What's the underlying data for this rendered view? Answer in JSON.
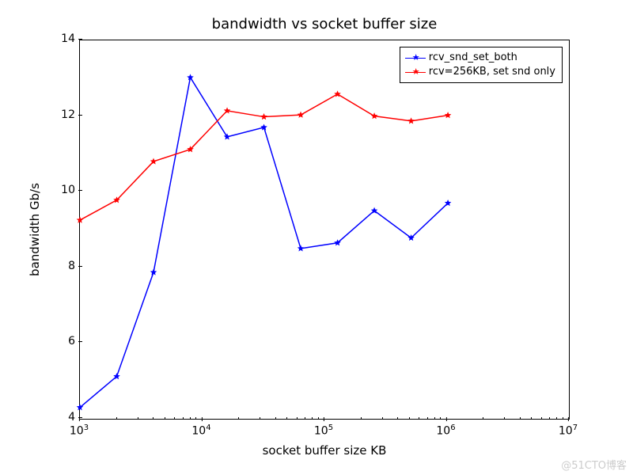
{
  "chart_data": {
    "type": "line",
    "title": "bandwidth vs socket buffer size",
    "xlabel": "socket buffer size KB",
    "ylabel": "bandwidth Gb/s",
    "x_scale": "log",
    "xlim": [
      1000,
      10000000
    ],
    "ylim": [
      4,
      14
    ],
    "xticks_exp": [
      3,
      4,
      5,
      6,
      7
    ],
    "yticks": [
      4,
      6,
      8,
      10,
      12,
      14
    ],
    "x": [
      1000,
      2000,
      4000,
      8000,
      16000,
      32000,
      64000,
      128000,
      256000,
      512000,
      1024000
    ],
    "series": [
      {
        "name": "rcv_snd_set_both",
        "color": "#0000ff",
        "values": [
          4.3,
          5.12,
          7.87,
          13.02,
          11.45,
          11.7,
          8.5,
          8.65,
          9.5,
          8.78,
          9.7
        ]
      },
      {
        "name": "rcv=256KB, set snd only",
        "color": "#ff0000",
        "values": [
          9.25,
          9.78,
          10.8,
          11.12,
          12.14,
          11.98,
          12.03,
          12.58,
          12.0,
          11.87,
          12.02
        ]
      }
    ],
    "legend_position": "upper right",
    "marker": "star"
  },
  "watermark": "@51CTO博客"
}
